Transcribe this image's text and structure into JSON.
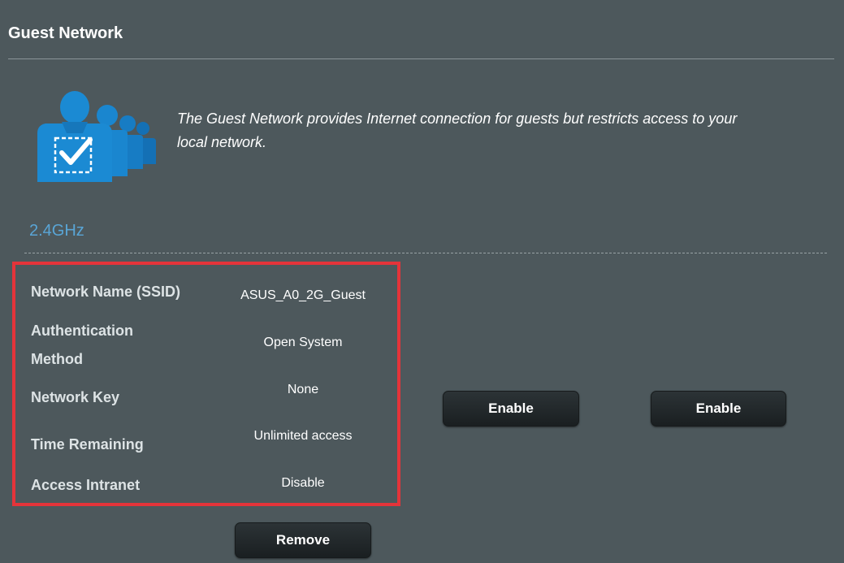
{
  "page": {
    "title": "Guest Network",
    "description": "The Guest Network provides Internet connection for guests but restricts access to your local network."
  },
  "icon": {
    "name": "guest-network-users-icon",
    "color": "#1b8ad3"
  },
  "band": {
    "label": "2.4GHz",
    "color": "#59a5d6"
  },
  "fields": [
    {
      "label": "Network Name (SSID)",
      "value": "ASUS_A0_2G_Guest"
    },
    {
      "label": "Authentication Method",
      "value": "Open System"
    },
    {
      "label": "Network Key",
      "value": "None"
    },
    {
      "label": "Time Remaining",
      "value": "Unlimited access"
    },
    {
      "label": "Access Intranet",
      "value": "Disable"
    }
  ],
  "buttons": {
    "remove": "Remove",
    "enable_1": "Enable",
    "enable_2": "Enable"
  },
  "colors": {
    "background": "#4d585c",
    "highlight": "#e5343a",
    "button": "#1f2527"
  }
}
